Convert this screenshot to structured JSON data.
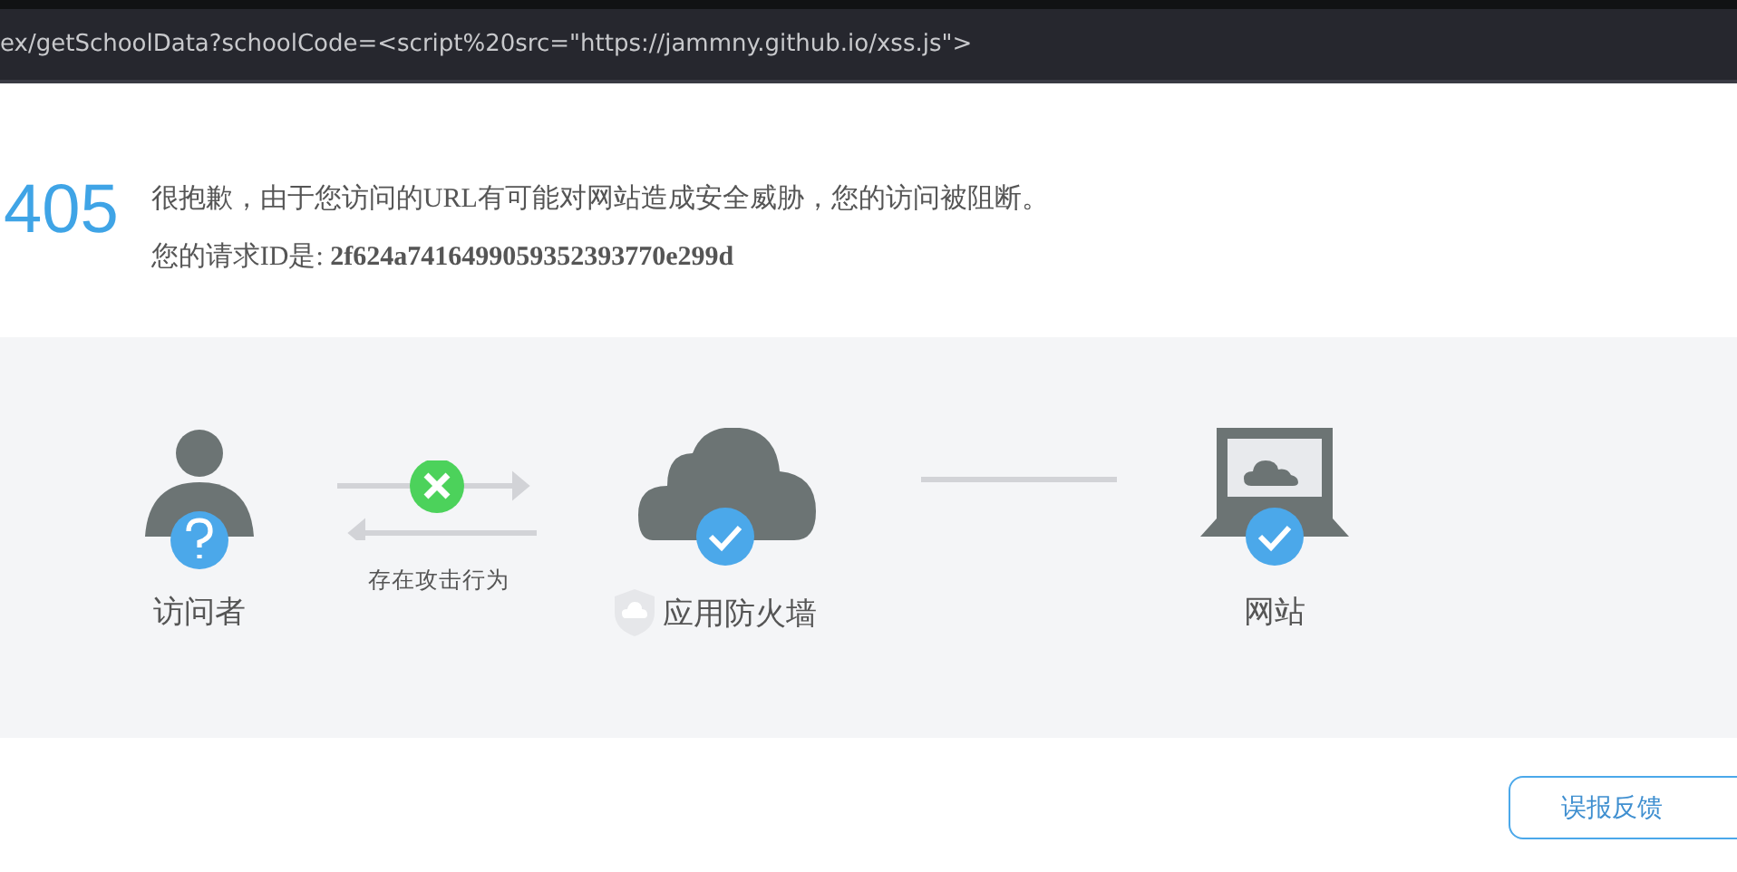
{
  "address_bar": {
    "url": "ex/getSchoolData?schoolCode=<script%20src=\"https://jammny.github.io/xss.js\">"
  },
  "error": {
    "code": "405",
    "message": "很抱歉，由于您访问的URL有可能对网站造成安全威胁，您的访问被阻断。",
    "request_id_label": "您的请求ID是:",
    "request_id": "2f624a7416499059352393770e299d"
  },
  "diagram": {
    "nodes": [
      {
        "kind": "visitor",
        "label": "访问者",
        "verified": false
      },
      {
        "kind": "link",
        "label": "存在攻击行为",
        "blocked": true
      },
      {
        "kind": "firewall",
        "label": "应用防火墙",
        "verified": true
      },
      {
        "kind": "line"
      },
      {
        "kind": "website",
        "label": "网站",
        "verified": true
      }
    ]
  },
  "feedback_button": {
    "label": "误报反馈"
  }
}
